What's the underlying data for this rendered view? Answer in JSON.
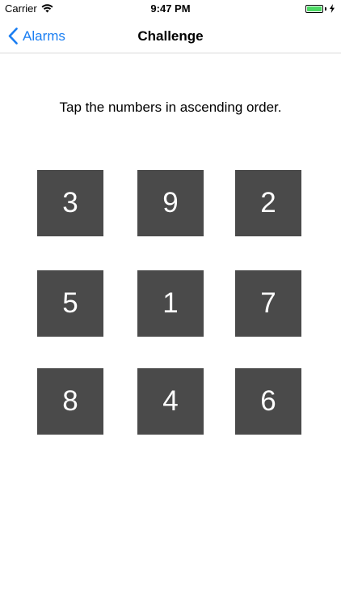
{
  "status_bar": {
    "carrier": "Carrier",
    "time": "9:47 PM",
    "battery_level": 1.0,
    "battery_color": "#4cd964",
    "charging": true
  },
  "nav": {
    "back_label": "Alarms",
    "title": "Challenge",
    "tint_color": "#1a7ef2"
  },
  "instruction": "Tap the numbers in ascending order.",
  "tiles": [
    "3",
    "9",
    "2",
    "5",
    "1",
    "7",
    "8",
    "4",
    "6"
  ],
  "tile_color": "#4a4a4a"
}
